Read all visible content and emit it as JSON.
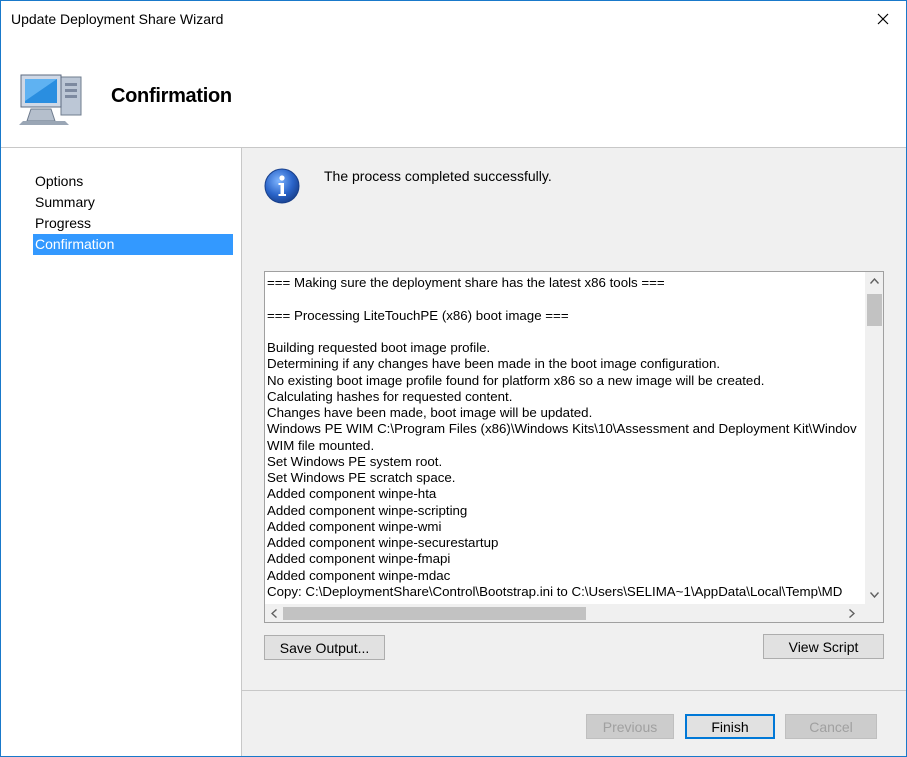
{
  "window": {
    "title": "Update Deployment Share Wizard"
  },
  "header": {
    "title": "Confirmation",
    "icon": "computer-icon"
  },
  "sidebar": {
    "items": [
      {
        "label": "Options",
        "active": false
      },
      {
        "label": "Summary",
        "active": false
      },
      {
        "label": "Progress",
        "active": false
      },
      {
        "label": "Confirmation",
        "active": true
      }
    ]
  },
  "main": {
    "status": "The process completed successfully.",
    "status_icon": "info-icon",
    "log": [
      "=== Making sure the deployment share has the latest x86 tools ===",
      "",
      "=== Processing LiteTouchPE (x86) boot image ===",
      "",
      "Building requested boot image profile.",
      "Determining if any changes have been made in the boot image configuration.",
      "No existing boot image profile found for platform x86 so a new image will be created.",
      "Calculating hashes for requested content.",
      "Changes have been made, boot image will be updated.",
      "Windows PE WIM C:\\Program Files (x86)\\Windows Kits\\10\\Assessment and Deployment Kit\\Windov",
      "WIM file mounted.",
      "Set Windows PE system root.",
      "Set Windows PE scratch space.",
      "Added component winpe-hta",
      "Added component winpe-scripting",
      "Added component winpe-wmi",
      "Added component winpe-securestartup",
      "Added component winpe-fmapi",
      "Added component winpe-mdac",
      "Copy: C:\\DeploymentShare\\Control\\Bootstrap.ini to C:\\Users\\SELIMA~1\\AppData\\Local\\Temp\\MD"
    ],
    "save_output_label": "Save Output...",
    "view_script_label": "View Script"
  },
  "footer": {
    "previous_label": "Previous",
    "finish_label": "Finish",
    "cancel_label": "Cancel"
  },
  "colors": {
    "accent": "#3399ff",
    "border": "#1979ca"
  }
}
